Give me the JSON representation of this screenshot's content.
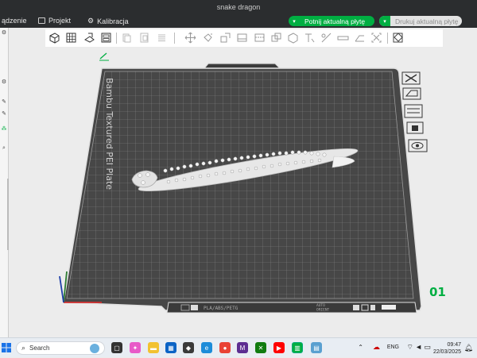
{
  "window": {
    "title": "snake dragon"
  },
  "menubar": {
    "items": [
      {
        "label": "ądzenie",
        "icon": "device-icon"
      },
      {
        "label": "Projekt",
        "icon": "project-icon"
      },
      {
        "label": "Kalibracja",
        "icon": "calibration-icon"
      }
    ],
    "slice_button": "Potnij aktualną płytę",
    "print_button": "Drukuj aktualną płytę"
  },
  "plate": {
    "name": "Bambu Textured PEI Plate",
    "number": "01",
    "footer_filament": "PLA/ABS/PETG",
    "footer_badges": [
      "AUTO",
      "ORIENT"
    ]
  },
  "taskbar": {
    "search_placeholder": "Search",
    "language": "ENG",
    "time": "09:47",
    "date": "22/03/2025"
  },
  "colors": {
    "accent": "#00ae42",
    "plate": "#4a4a4a",
    "titlebar": "#2b2d2f",
    "axis_x": "#d32f2f",
    "axis_y": "#2e7d32",
    "axis_z": "#1e3fa8"
  }
}
